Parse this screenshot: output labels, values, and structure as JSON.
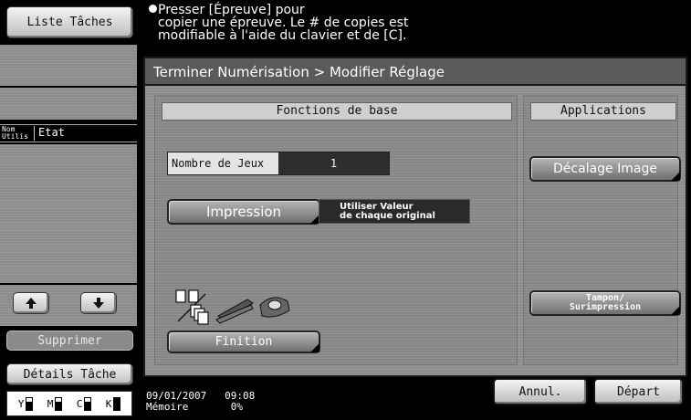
{
  "sidebar": {
    "job_list_label": "Liste Tâches",
    "col_user_line1": "Nom",
    "col_user_line2": "Utilis",
    "col_status": "Etat",
    "delete_label": "Supprimer",
    "job_details_label": "Détails Tâche",
    "toner_labels": [
      "Y",
      "M",
      "C",
      "K"
    ]
  },
  "message": {
    "line1": "Presser [Épreuve] pour",
    "line2": "copier une épreuve. Le # de copies est",
    "line3": "modifiable à l'aide du clavier et de [C]."
  },
  "breadcrumb": "Terminer Numérisation > Modifier Réglage",
  "basic": {
    "header": "Fonctions de base",
    "sets_label": "Nombre de Jeux",
    "sets_value": "1",
    "print_label": "Impression",
    "print_value_line1": "Utiliser Valeur",
    "print_value_line2": "de chaque original",
    "finishing_label": "Finition"
  },
  "applications": {
    "header": "Applications",
    "image_shift_label": "Décalage Image",
    "stamp_line1": "Tampon/",
    "stamp_line2": "Surimpression"
  },
  "status": {
    "date": "09/01/2007",
    "time": "09:08",
    "memory_label": "Mémoire",
    "memory_value": "0%"
  },
  "footer": {
    "cancel_label": "Annul.",
    "start_label": "Départ"
  }
}
